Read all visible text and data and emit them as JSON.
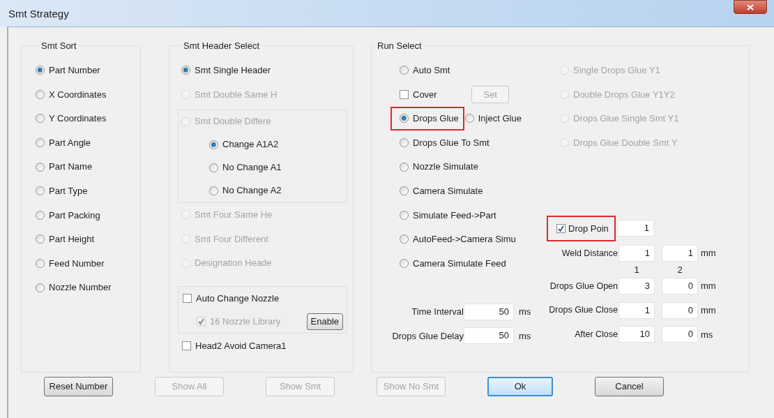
{
  "window": {
    "title": "Smt Strategy"
  },
  "smt_sort": {
    "title": "Smt Sort",
    "options": [
      {
        "label": "Part Number",
        "selected": true
      },
      {
        "label": "X Coordinates",
        "selected": false
      },
      {
        "label": "Y Coordinates",
        "selected": false
      },
      {
        "label": "Part Angle",
        "selected": false
      },
      {
        "label": "Part Name",
        "selected": false
      },
      {
        "label": "Part Type",
        "selected": false
      },
      {
        "label": "Part Packing",
        "selected": false
      },
      {
        "label": "Part Height",
        "selected": false
      },
      {
        "label": "Feed Number",
        "selected": false
      },
      {
        "label": "Nozzle Number",
        "selected": false
      }
    ]
  },
  "smt_header_select": {
    "title": "Smt Header Select",
    "items": [
      {
        "kind": "radio",
        "label": "Smt Single Header",
        "selected": true,
        "disabled": false
      },
      {
        "kind": "radio",
        "label": "Smt Double Same H",
        "selected": false,
        "disabled": true
      },
      {
        "kind": "group",
        "label": "Smt Double Differe",
        "selected": false,
        "disabled": true,
        "children": [
          {
            "label": "Change A1A2",
            "selected": true,
            "disabled": false
          },
          {
            "label": "No Change A1",
            "selected": false,
            "disabled": false
          },
          {
            "label": "No Change A2",
            "selected": false,
            "disabled": false
          }
        ]
      },
      {
        "kind": "radio",
        "label": "Smt Four Same He",
        "selected": false,
        "disabled": true
      },
      {
        "kind": "radio",
        "label": "Smt Four Different",
        "selected": false,
        "disabled": true
      },
      {
        "kind": "radio",
        "label": "Designation Heade",
        "selected": false,
        "disabled": true
      }
    ],
    "nozzle": {
      "auto_change": {
        "label": "Auto Change Nozzle",
        "checked": false,
        "disabled": false
      },
      "library": {
        "label": "16 Nozzle Library",
        "checked": true,
        "disabled": true
      },
      "button": {
        "label": "Enable",
        "disabled": false
      }
    },
    "head2_avoid": {
      "label": "Head2 Avoid Camera1",
      "checked": false,
      "disabled": false
    }
  },
  "run_select": {
    "title": "Run Select",
    "left_options": [
      {
        "kind": "radio",
        "label": "Auto Smt",
        "selected": false
      },
      {
        "kind": "checkbox",
        "label": "Cover",
        "checked": false,
        "button": {
          "label": "Set",
          "disabled": true
        }
      },
      {
        "kind": "radio_pair",
        "options": [
          {
            "label": "Drops Glue",
            "selected": true,
            "highlighted": true
          },
          {
            "label": "Inject Glue",
            "selected": false,
            "highlighted": false
          }
        ]
      },
      {
        "kind": "radio",
        "label": "Drops Glue To Smt",
        "selected": false
      },
      {
        "kind": "radio",
        "label": "Nozzle Simulate",
        "selected": false
      },
      {
        "kind": "radio",
        "label": "Camera Simulate",
        "selected": false
      },
      {
        "kind": "radio",
        "label": "Simulate Feed->Part",
        "selected": false
      },
      {
        "kind": "radio",
        "label": "AutoFeed->Camera Simu",
        "selected": false
      },
      {
        "kind": "radio",
        "label": "Camera Simulate Feed",
        "selected": false
      }
    ],
    "right_options": [
      {
        "label": "Single Drops Glue Y1",
        "selected": false,
        "disabled": true
      },
      {
        "label": "Double Drops Glue Y1Y2",
        "selected": false,
        "disabled": true
      },
      {
        "label": "Drops Glue Single Smt Y1",
        "selected": false,
        "disabled": true
      },
      {
        "label": "Drops Glue Double Smt Y",
        "selected": false,
        "disabled": true
      }
    ],
    "timing_fields": [
      {
        "label": "Time Interval",
        "value": "50",
        "unit": "ms"
      },
      {
        "label": "Drops Glue Delay",
        "value": "50",
        "unit": "ms"
      }
    ],
    "drop_point": {
      "label": "Drop Poin",
      "checked": true,
      "highlighted": true,
      "value": "1"
    },
    "weld_distance": {
      "label": "Weld Distance",
      "values": [
        "1",
        "1"
      ],
      "unit": "mm"
    },
    "column_headers": [
      "1",
      "2"
    ],
    "glue_params": [
      {
        "label": "Drops Glue Open",
        "values": [
          "3",
          "0"
        ],
        "unit": "mm"
      },
      {
        "label": "Drops Glue Close",
        "values": [
          "1",
          "0"
        ],
        "unit": "mm"
      },
      {
        "label": "After Close",
        "values": [
          "10",
          "0"
        ],
        "unit": "ms"
      }
    ]
  },
  "buttons": [
    {
      "label": "Reset Number",
      "disabled": false,
      "default": false
    },
    {
      "label": "Show All",
      "disabled": true,
      "default": false
    },
    {
      "label": "Show Smt",
      "disabled": true,
      "default": false
    },
    {
      "label": "Show No Smt",
      "disabled": true,
      "default": false
    },
    {
      "label": "Ok",
      "disabled": false,
      "default": true
    },
    {
      "label": "Cancel",
      "disabled": false,
      "default": false
    }
  ]
}
